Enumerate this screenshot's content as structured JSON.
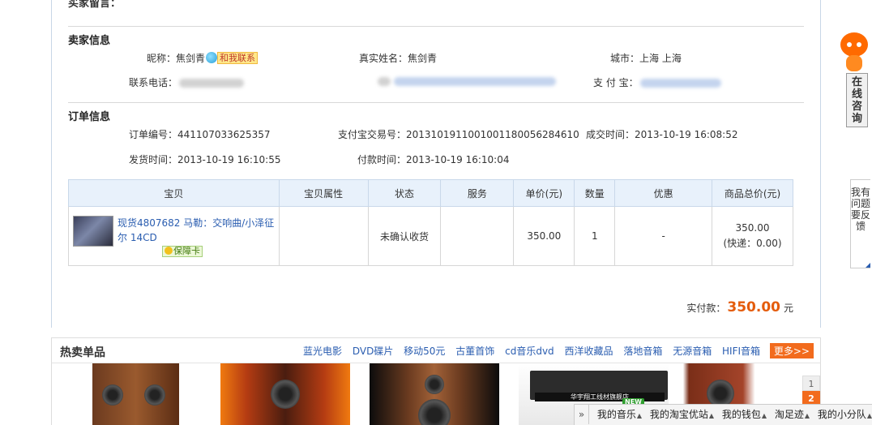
{
  "cut_heading": "买家留言：",
  "seller": {
    "title": "卖家信息",
    "nick_label": "昵称：",
    "nick_value": "焦剑青",
    "contact_label": "和我联系",
    "realname_label": "真实姓名：",
    "realname_value": "焦剑青",
    "city_label": "城市：",
    "city_value": "上海 上海",
    "phone_label": "联系电话：",
    "alipay_label": "支 付 宝："
  },
  "order": {
    "title": "订单信息",
    "no_label": "订单编号：",
    "no_value": "441107033625357",
    "alipay_no_label": "支付宝交易号：",
    "alipay_no_value": "2013101911001001180056284610",
    "deal_time_label": "成交时间：",
    "deal_time_value": "2013-10-19 16:08:52",
    "ship_time_label": "发货时间：",
    "ship_time_value": "2013-10-19 16:10:55",
    "pay_time_label": "付款时间：",
    "pay_time_value": "2013-10-19 16:10:04"
  },
  "table": {
    "headers": [
      "宝贝",
      "宝贝属性",
      "状态",
      "服务",
      "单价(元)",
      "数量",
      "优惠",
      "商品总价(元)"
    ],
    "row": {
      "item_title": "现货4807682 马勒：交响曲/小泽征尔 14CD",
      "guarantee": "保障卡",
      "attr": "",
      "status": "未确认收货",
      "service": "",
      "price": "350.00",
      "qty": "1",
      "discount": "-",
      "total": "350.00",
      "shipping": "(快递：0.00)"
    }
  },
  "paid": {
    "label": "实付款：",
    "amount": "350.00",
    "unit": "元"
  },
  "hot": {
    "title": "热卖单品",
    "links": [
      "蓝光电影",
      "DVD碟片",
      "移动50元",
      "古董首饰",
      "cd音乐dvd",
      "西洋收藏品",
      "落地音箱",
      "无源音箱",
      "HIFI音箱"
    ],
    "more": "更多>>",
    "pager": [
      "1",
      "2"
    ],
    "promo_text": "华宇翔工线材旗舰店"
  },
  "side": {
    "online": "在线咨询",
    "feedback": "我有问题要反馈"
  },
  "bottom_bar": {
    "toggle": "»",
    "items": [
      "我的音乐",
      "我的淘宝优站",
      "我的钱包",
      "淘足迹",
      "我的小分队"
    ],
    "new_badge": "NEW"
  }
}
